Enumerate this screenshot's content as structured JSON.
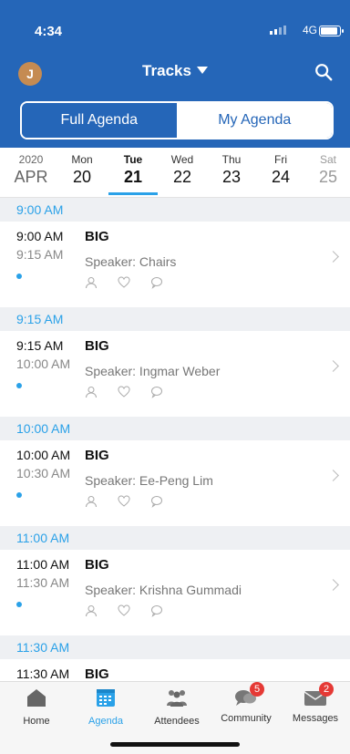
{
  "status": {
    "time": "4:34",
    "network": "4G"
  },
  "header": {
    "avatar_initial": "J",
    "title": "Tracks"
  },
  "segments": {
    "full": "Full Agenda",
    "mine": "My Agenda"
  },
  "dates": [
    {
      "top": "2020",
      "bottom": "APR"
    },
    {
      "top": "Mon",
      "bottom": "20"
    },
    {
      "top": "Tue",
      "bottom": "21"
    },
    {
      "top": "Wed",
      "bottom": "22"
    },
    {
      "top": "Thu",
      "bottom": "23"
    },
    {
      "top": "Fri",
      "bottom": "24"
    },
    {
      "top": "Sat",
      "bottom": "25"
    }
  ],
  "sessions": [
    {
      "header": "9:00 AM",
      "start": "9:00 AM",
      "end": "9:15 AM",
      "title": "BIG",
      "speaker": "Speaker: Chairs"
    },
    {
      "header": "9:15 AM",
      "start": "9:15 AM",
      "end": "10:00 AM",
      "title": "BIG",
      "speaker": "Speaker: Ingmar Weber"
    },
    {
      "header": "10:00 AM",
      "start": "10:00 AM",
      "end": "10:30 AM",
      "title": "BIG",
      "speaker": "Speaker: Ee-Peng Lim"
    },
    {
      "header": "11:00 AM",
      "start": "11:00 AM",
      "end": "11:30 AM",
      "title": "BIG",
      "speaker": "Speaker: Krishna Gummadi"
    },
    {
      "header": "11:30 AM",
      "start": "11:30 AM",
      "end": "",
      "title": "BIG",
      "speaker": ""
    }
  ],
  "tabs": [
    {
      "label": "Home"
    },
    {
      "label": "Agenda"
    },
    {
      "label": "Attendees"
    },
    {
      "label": "Community",
      "badge": "5"
    },
    {
      "label": "Messages",
      "badge": "2"
    }
  ],
  "colors": {
    "primary": "#2566b8",
    "accent": "#2aa1e8",
    "badge": "#e53935"
  }
}
